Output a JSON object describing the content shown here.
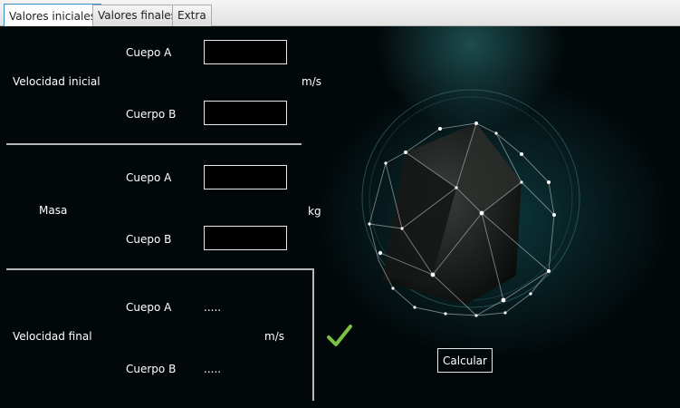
{
  "tabs": [
    {
      "label": "Valores iniciales"
    },
    {
      "label": "Valores finales"
    },
    {
      "label": "Extra"
    }
  ],
  "velocidad_inicial": {
    "label": "Velocidad inicial",
    "unit": "m/s",
    "cuerpo_a_label": "Cuepo A",
    "cuerpo_a_value": "",
    "cuerpo_b_label": "Cuerpo B",
    "cuerpo_b_value": ""
  },
  "masa": {
    "label": "Masa",
    "unit": "kg",
    "cuerpo_a_label": "Cuepo A",
    "cuerpo_a_value": "",
    "cuerpo_b_label": "Cuepo B",
    "cuerpo_b_value": ""
  },
  "velocidad_final": {
    "label": "Velocidad final",
    "unit": "m/s",
    "cuerpo_a_label": "Cuepo A",
    "cuerpo_a_value": ".....",
    "cuerpo_b_label": "Cuerpo B",
    "cuerpo_b_value": "....."
  },
  "calcular_label": "Calcular",
  "colors": {
    "accent_check": "#7cc242",
    "tab_active_border": "#3c8ec9",
    "teal_glow": "#1b6a6e"
  },
  "icons": {
    "check": "checkmark-icon",
    "decoration": "geometric-sphere-illustration"
  }
}
